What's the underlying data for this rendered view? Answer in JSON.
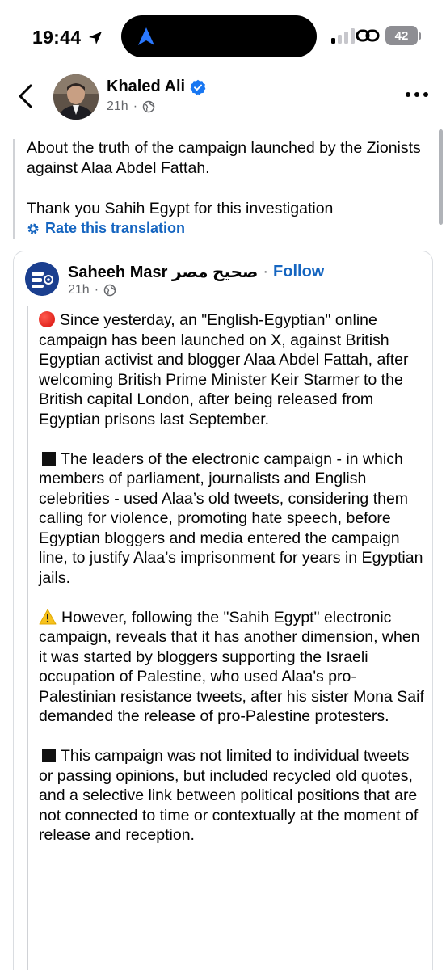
{
  "status_bar": {
    "time": "19:44",
    "battery": "42"
  },
  "header": {
    "author_name": "Khaled Ali",
    "timestamp": "21h"
  },
  "post": {
    "paragraphs": [
      "About the truth of the campaign launched by the Zionists against Alaa Abdel Fattah.",
      "Thank you Sahih Egypt for this investigation"
    ],
    "rate_translation": "Rate this translation"
  },
  "shared": {
    "page_name": "Saheeh Masr صحيح مصر",
    "separator": "·",
    "follow": "Follow",
    "timestamp": "21h",
    "paragraphs": [
      "Since yesterday, an \"English-Egyptian\" online campaign has been launched on X, against British Egyptian activist and blogger Alaa Abdel Fattah, after welcoming British Prime Minister Keir Starmer to the British capital London, after being released from Egyptian prisons last September.",
      "The leaders of the electronic campaign - in which members of parliament, journalists and English celebrities - used Alaa’s old tweets, considering them calling for violence, promoting hate speech, before Egyptian bloggers and media entered the campaign line, to justify Alaa’s imprisonment for years in Egyptian jails.",
      "However, following the \"Sahih Egypt\" electronic campaign, reveals that it has another dimension, when it was started by bloggers supporting the Israeli occupation of Palestine, who used Alaa's pro-Palestinian resistance tweets, after his sister Mona Saif demanded the release of pro-Palestine protesters.",
      "This campaign was not limited to individual tweets or passing opinions, but included recycled old quotes, and a selective link between political positions that are not connected to time or contextually at the moment of release and reception."
    ]
  },
  "colors": {
    "link_blue": "#1565c0",
    "verified_blue": "#1877f2",
    "muted_text": "#65676b"
  },
  "icons": [
    "location-arrow-icon",
    "navigation-icon",
    "signal-icon",
    "link-icon",
    "battery-icon",
    "back-chevron-icon",
    "verified-badge-icon",
    "globe-icon",
    "more-options-icon",
    "gear-icon",
    "red-circle-emoji",
    "black-square-emoji",
    "warning-emoji"
  ]
}
